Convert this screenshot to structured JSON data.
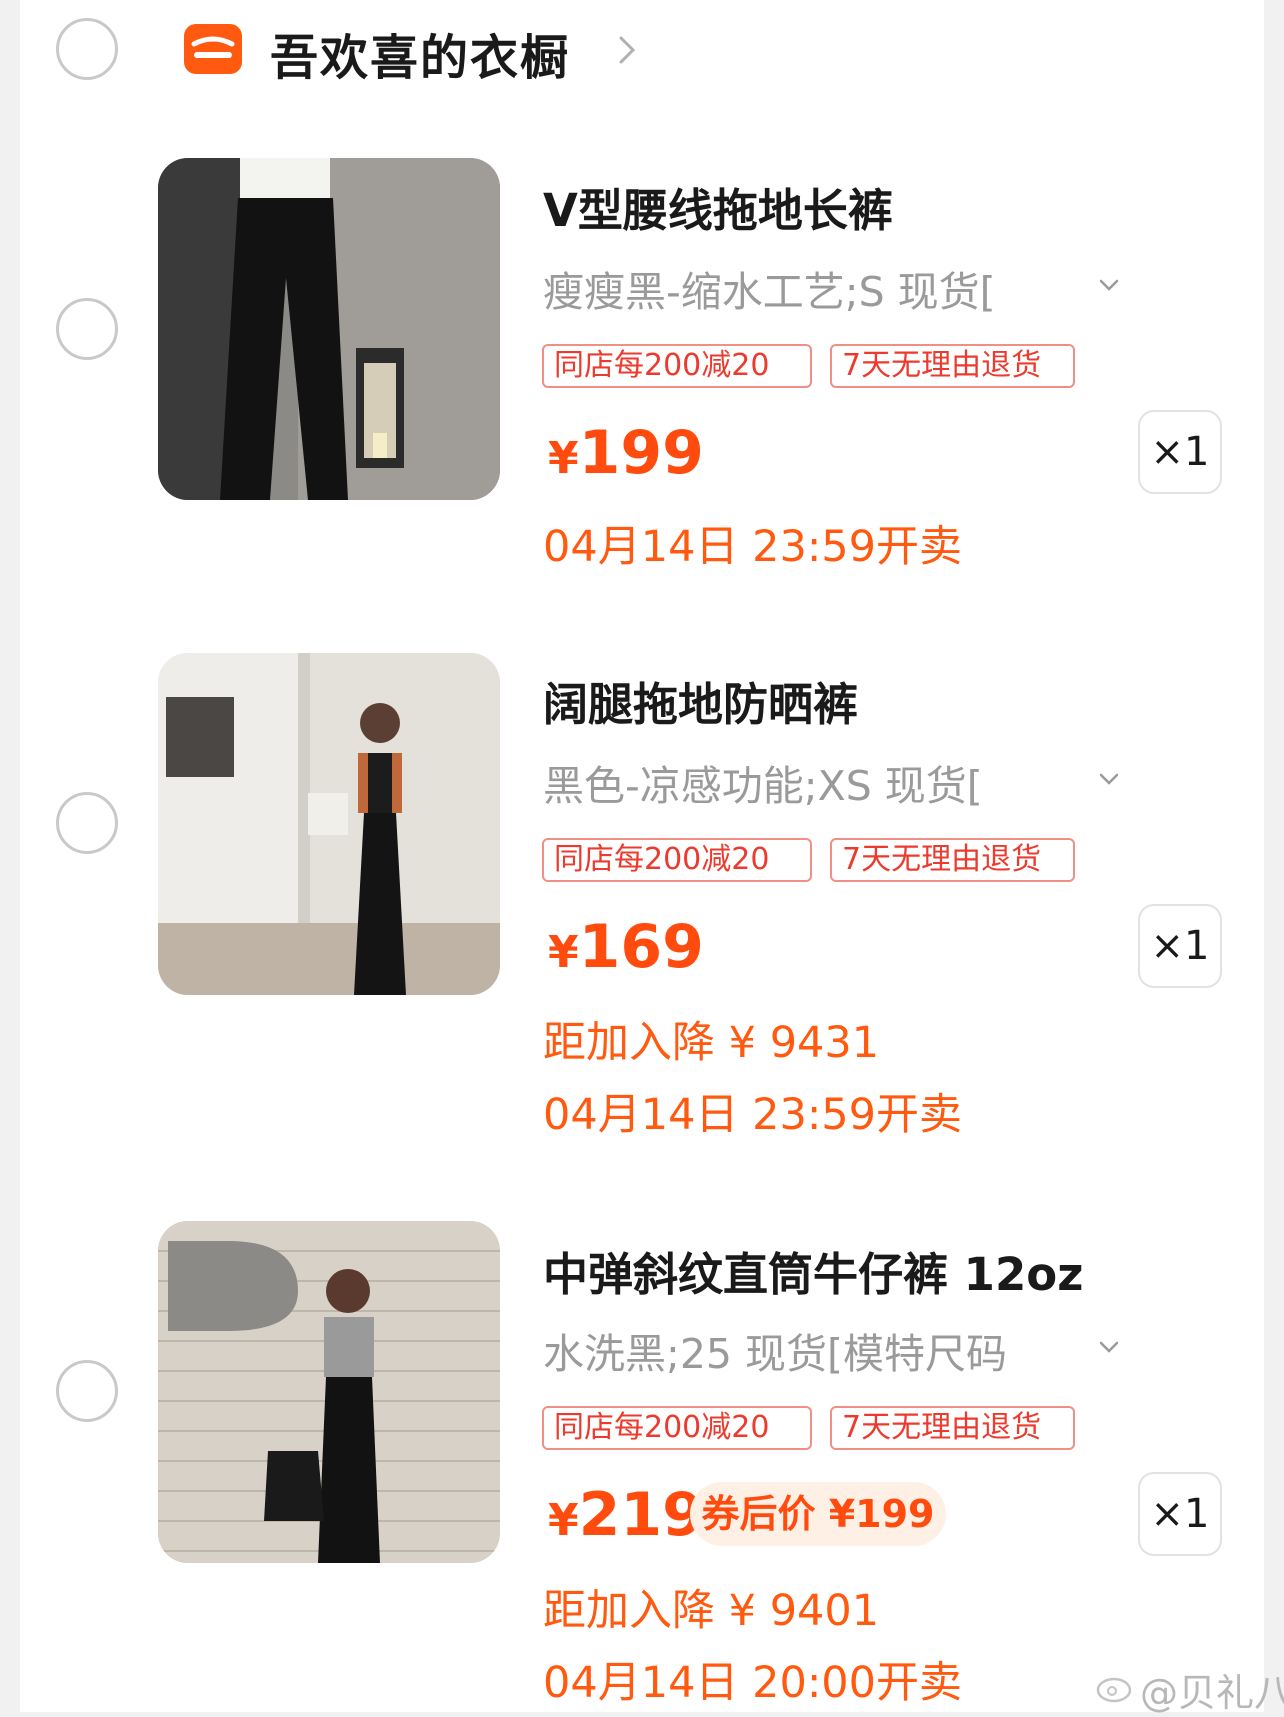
{
  "shop": {
    "name": "吾欢喜的衣橱",
    "logo_icon": "shop-basket-icon",
    "brand_color": "#ff5a10"
  },
  "items": [
    {
      "title": "V型腰线拖地长裤",
      "sku": "瘦瘦黑-缩水工艺;S 现货[",
      "tags": [
        "同店每200减20",
        "7天无理由退货"
      ],
      "currency": "¥",
      "price": "199",
      "sale_time": "04月14日 23:59开卖",
      "quantity": "×1"
    },
    {
      "title": "阔腿拖地防晒裤",
      "sku": "黑色-凉感功能;XS 现货[",
      "tags": [
        "同店每200减20",
        "7天无理由退货"
      ],
      "currency": "¥",
      "price": "169",
      "drop_note": "距加入降 ¥ 9431",
      "sale_time": "04月14日 23:59开卖",
      "quantity": "×1"
    },
    {
      "title": "中弹斜纹直筒牛仔裤 12oz",
      "sku": "水洗黑;25 现货[模特尺码",
      "tags": [
        "同店每200减20",
        "7天无理由退货"
      ],
      "currency": "¥",
      "price": "219",
      "coupon_price": "券后价 ¥199",
      "drop_note": "距加入降 ¥ 9401",
      "sale_time": "04月14日 20:00开卖",
      "quantity": "×1"
    }
  ],
  "watermark": "@贝礼八"
}
